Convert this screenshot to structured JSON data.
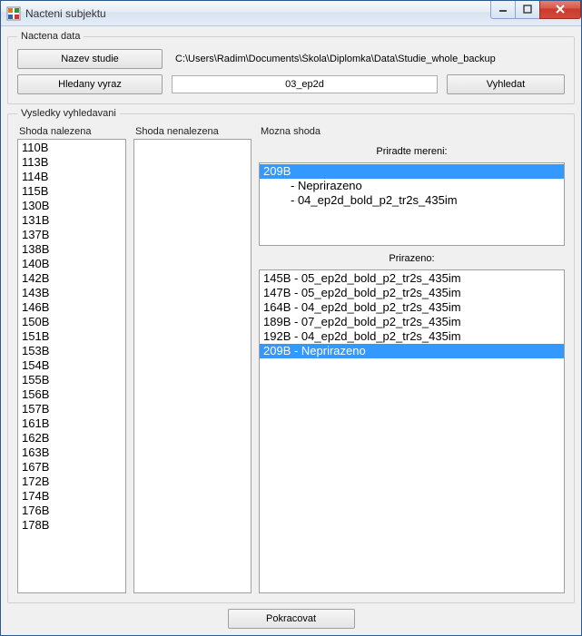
{
  "window": {
    "title": "Nacteni subjektu"
  },
  "loaded_data": {
    "legend": "Nactena data",
    "study_btn": "Nazev studie",
    "study_path": "C:\\Users\\Radim\\Documents\\Škola\\Diplomka\\Data\\Studie_whole_backup",
    "search_label": "Hledany vyraz",
    "search_value": "03_ep2d",
    "search_btn": "Vyhledat"
  },
  "results": {
    "legend": "Vysledky vyhledavani",
    "found_header": "Shoda nalezena",
    "notfound_header": "Shoda nenalezena",
    "possible_header": "Mozna shoda",
    "found_items": [
      "110B",
      "113B",
      "114B",
      "115B",
      "130B",
      "131B",
      "137B",
      "138B",
      "140B",
      "142B",
      "143B",
      "146B",
      "150B",
      "151B",
      "153B",
      "154B",
      "155B",
      "156B",
      "157B",
      "161B",
      "162B",
      "163B",
      "167B",
      "172B",
      "174B",
      "176B",
      "178B"
    ],
    "notfound_items": [],
    "assign_label": "Priradte mereni:",
    "tree": {
      "root": "209B",
      "children": [
        "- Neprirazeno",
        "- 04_ep2d_bold_p2_tr2s_435im"
      ]
    },
    "assigned_label": "Prirazeno:",
    "assigned_items": [
      "145B - 05_ep2d_bold_p2_tr2s_435im",
      "147B - 05_ep2d_bold_p2_tr2s_435im",
      "164B - 04_ep2d_bold_p2_tr2s_435im",
      "189B - 07_ep2d_bold_p2_tr2s_435im",
      "192B - 04_ep2d_bold_p2_tr2s_435im",
      "209B - Neprirazeno"
    ]
  },
  "continue_btn": "Pokracovat"
}
